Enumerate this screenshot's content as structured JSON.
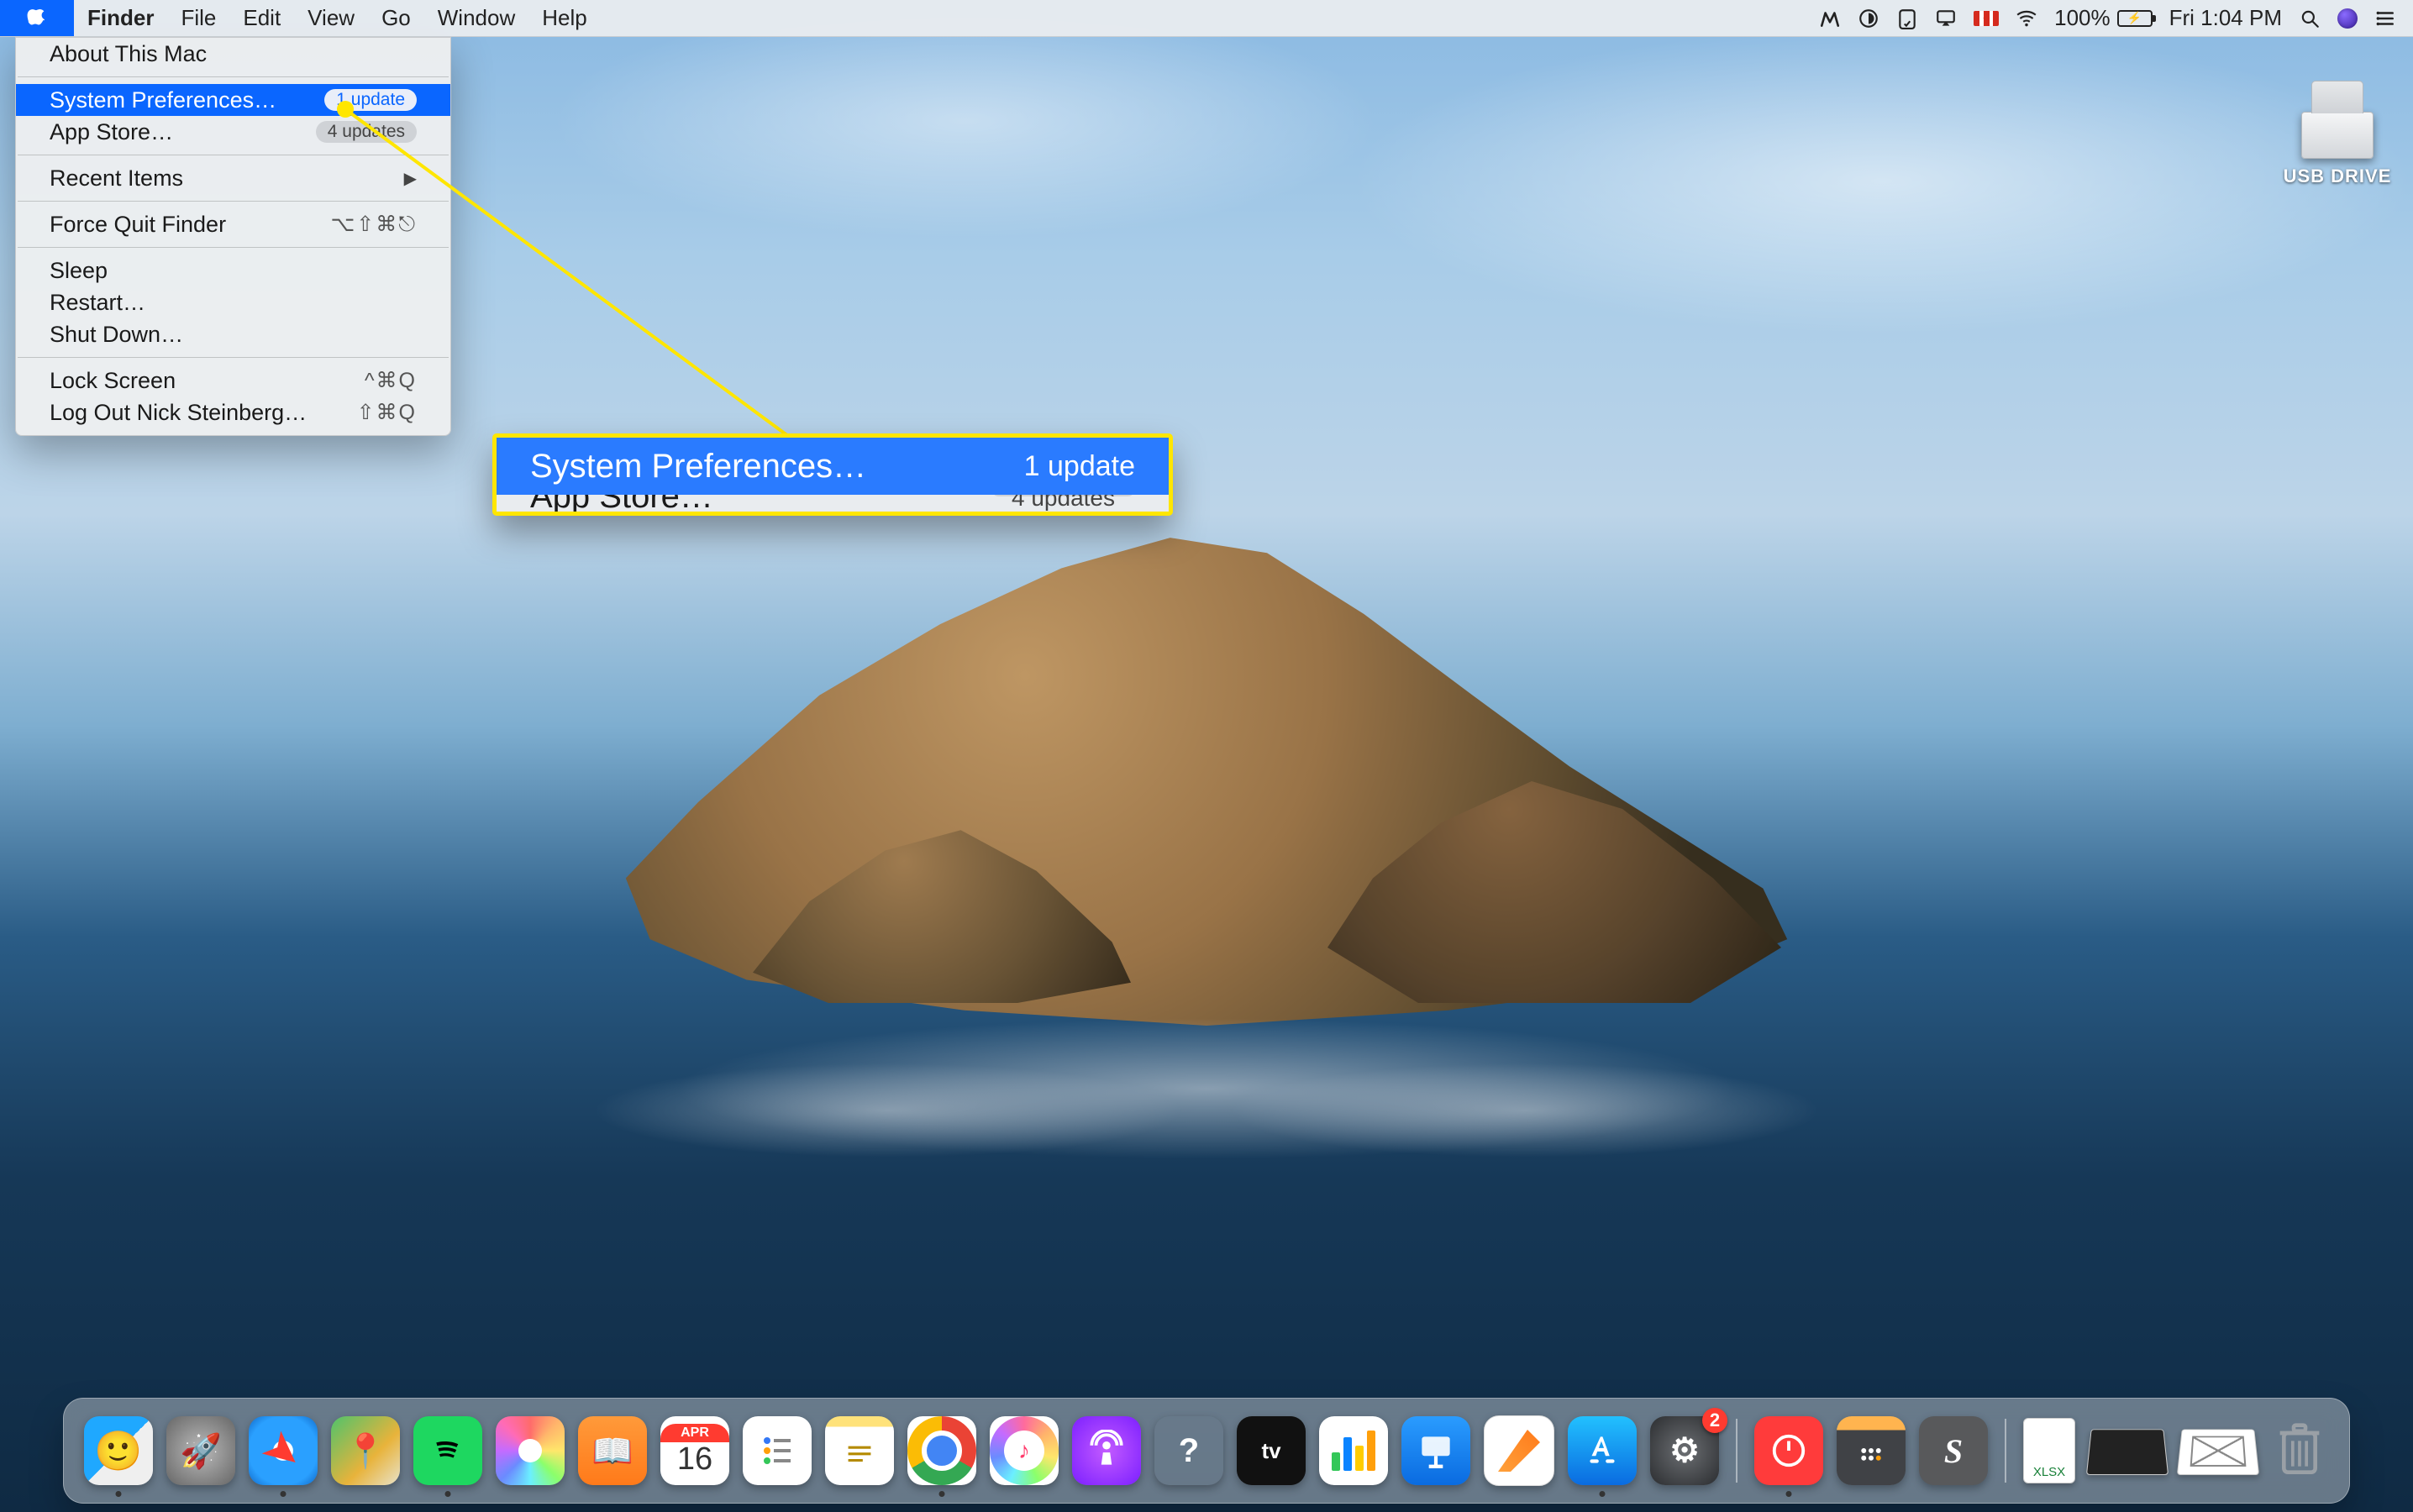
{
  "menubar": {
    "app_name": "Finder",
    "menus": [
      "File",
      "Edit",
      "View",
      "Go",
      "Window",
      "Help"
    ],
    "battery_pct": "100%",
    "clock": "Fri 1:04 PM",
    "flag_country": "Canada"
  },
  "apple_menu": {
    "about": "About This Mac",
    "sys_prefs": {
      "label": "System Preferences…",
      "badge": "1 update"
    },
    "app_store": {
      "label": "App Store…",
      "badge": "4 updates"
    },
    "recent_items": "Recent Items",
    "force_quit": {
      "label": "Force Quit Finder",
      "shortcut": "⌥⇧⌘⎋"
    },
    "sleep": "Sleep",
    "restart": "Restart…",
    "shut_down": "Shut Down…",
    "lock_screen": {
      "label": "Lock Screen",
      "shortcut": "^⌘Q"
    },
    "log_out": {
      "label": "Log Out Nick Steinberg…",
      "shortcut": "⇧⌘Q"
    }
  },
  "callout": {
    "label": "System Preferences…",
    "badge": "1 update",
    "peek_label": "App Store…",
    "peek_badge": "4 updates"
  },
  "desktop": {
    "drive_label": "USB DRIVE"
  },
  "dock": {
    "calendar": {
      "month": "APR",
      "day": "16"
    },
    "sysprefs_badge": "2",
    "xlsx_label": "XLSX",
    "tv_label": "tv"
  }
}
